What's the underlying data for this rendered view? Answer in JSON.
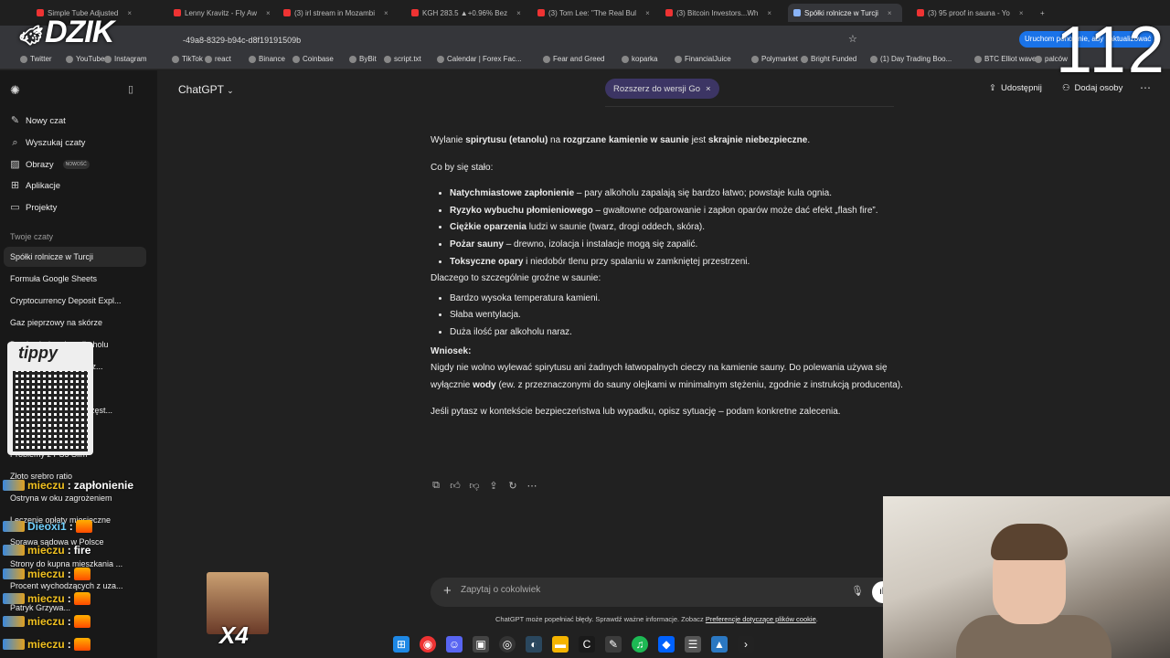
{
  "browser": {
    "tabs": [
      {
        "label": "Simple Tube Adjusted",
        "active": false
      },
      {
        "label": "Lenny Kravitz - Fly Aw",
        "active": false
      },
      {
        "label": "(3) irl stream in Mozambi",
        "active": false
      },
      {
        "label": "KGH 283.5 ▲+0.96% Bez",
        "active": false
      },
      {
        "label": "(3) Tom Lee: \"The Real Bul",
        "active": false
      },
      {
        "label": "(3) Bitcoin Investors...Wh",
        "active": false
      },
      {
        "label": "Spółki rolnicze w Turcji",
        "active": true
      },
      {
        "label": "(3) 95 proof in sauna - Yo",
        "active": false
      }
    ],
    "url": "-49a8-8329-b94c-d8f19191509b",
    "profile_button": "Uruchom ponownie, aby zaktualizować",
    "bookmarks": [
      "Twitter",
      "YouTube",
      "Instagram",
      "TikTok",
      "react",
      "Binance",
      "Coinbase",
      "ByBit",
      "script.txt",
      "Calendar | Forex Fac...",
      "Fear and Greed",
      "koparka",
      "FinancialJuice",
      "Polymarket",
      "Bright Funded",
      "(1) Day Trading Boo...",
      "BTC Elliot wave",
      "palców"
    ]
  },
  "overlay": {
    "logo": "DZIK",
    "counter": "112",
    "qr_title": "tippy",
    "emote_count": "X4",
    "chat": [
      {
        "user": "mieczu",
        "message": "zapłonienie"
      },
      {
        "user": "Dieoxi1",
        "message": ""
      },
      {
        "user": "mieczu",
        "message": "fire"
      },
      {
        "user": "mieczu",
        "message": ""
      },
      {
        "user": "mieczu",
        "message": ""
      },
      {
        "user": "mieczu",
        "message": ""
      },
      {
        "user": "mieczu",
        "message": ""
      }
    ]
  },
  "sidebar": {
    "items": [
      {
        "label": "Nowy czat",
        "icon": "edit-icon"
      },
      {
        "label": "Wyszukaj czaty",
        "icon": "search-icon"
      },
      {
        "label": "Obrazy",
        "icon": "image-icon",
        "badge": "NOWOŚĆ"
      },
      {
        "label": "Aplikacje",
        "icon": "apps-icon"
      },
      {
        "label": "Projekty",
        "icon": "folder-icon"
      }
    ],
    "section_title": "Twoje czaty",
    "chats": [
      "Spółki rolnicze w Turcji",
      "Formuła Google Sheets",
      "Cryptocurrency Deposit Expl...",
      "Gaz pieprzowy na skórze",
      "Dawka śmiertelna alkoholu",
      "Naprawa szyby Oszacz...",
      "Zbiornik gazowy wsp...",
      "Tarcza w sprawie pieczęst...",
      "Wykres ceny BTC",
      "Problemy z PS5 Slim",
      "Złoto srebro ratio",
      "Ostryna w oku zagrożeniem",
      "Leczenie opłaty miesięczne",
      "Sprawa sądowa w Polsce",
      "Strony do kupna mieszkania ...",
      "Procent wychodzących z uza...",
      "Patryk Grzywa..."
    ]
  },
  "header": {
    "model": "ChatGPT",
    "upgrade": "Rozszerz do wersji Go",
    "share": "Udostępnij",
    "add_people": "Dodaj osoby"
  },
  "answer": {
    "intro_pre": "Wylanie ",
    "intro_b1": "spirytusu (etanolu)",
    "intro_mid1": " na ",
    "intro_b2": "rozgrzane kamienie w saunie",
    "intro_mid2": " jest ",
    "intro_b3": "skrajnie niebezpieczne",
    "intro_post": ".",
    "what_happens": "Co by się stało:",
    "effects": [
      {
        "bold": "Natychmiastowe zapłonienie",
        "text": " – pary alkoholu zapalają się bardzo łatwo; powstaje kula ognia."
      },
      {
        "bold": "Ryzyko wybuchu płomieniowego",
        "text": " – gwałtowne odparowanie i zapłon oparów może dać efekt „flash fire”."
      },
      {
        "bold": "Ciężkie oparzenia",
        "text": " ludzi w saunie (twarz, drogi oddech, skóra)."
      },
      {
        "bold": "Pożar sauny",
        "text": " – drewno, izolacja i instalacje mogą się zapalić."
      },
      {
        "bold": "Toksyczne opary",
        "text": " i niedobór tlenu przy spalaniu w zamkniętej przestrzeni."
      }
    ],
    "why_title": "Dlaczego to szczególnie groźne w saunie:",
    "why": [
      "Bardzo wysoka temperatura kamieni.",
      "Słaba wentylacja.",
      "Duża ilość par alkoholu naraz."
    ],
    "conclusion_title": "Wniosek:",
    "conclusion_pre": "Nigdy nie wolno wylewać spirytusu ani żadnych łatwopalnych cieczy na kamienie sauny. Do polewania używa się wyłącznie ",
    "conclusion_b": "wody",
    "conclusion_post": " (ew. z przeznaczonymi do sauny olejkami w minimalnym stężeniu, zgodnie z instrukcją producenta).",
    "followup": "Jeśli pytasz w kontekście bezpieczeństwa lub wypadku, opisz sytuację – podam konkretne zalecenia."
  },
  "composer": {
    "placeholder": "Zapytaj o cokolwiek",
    "disclaimer": "ChatGPT może popełniać błędy. Sprawdź ważne informacje. Zobacz ",
    "disclaimer_link": "Preferencje dotyczące plików cookie",
    "disclaimer_end": "."
  }
}
